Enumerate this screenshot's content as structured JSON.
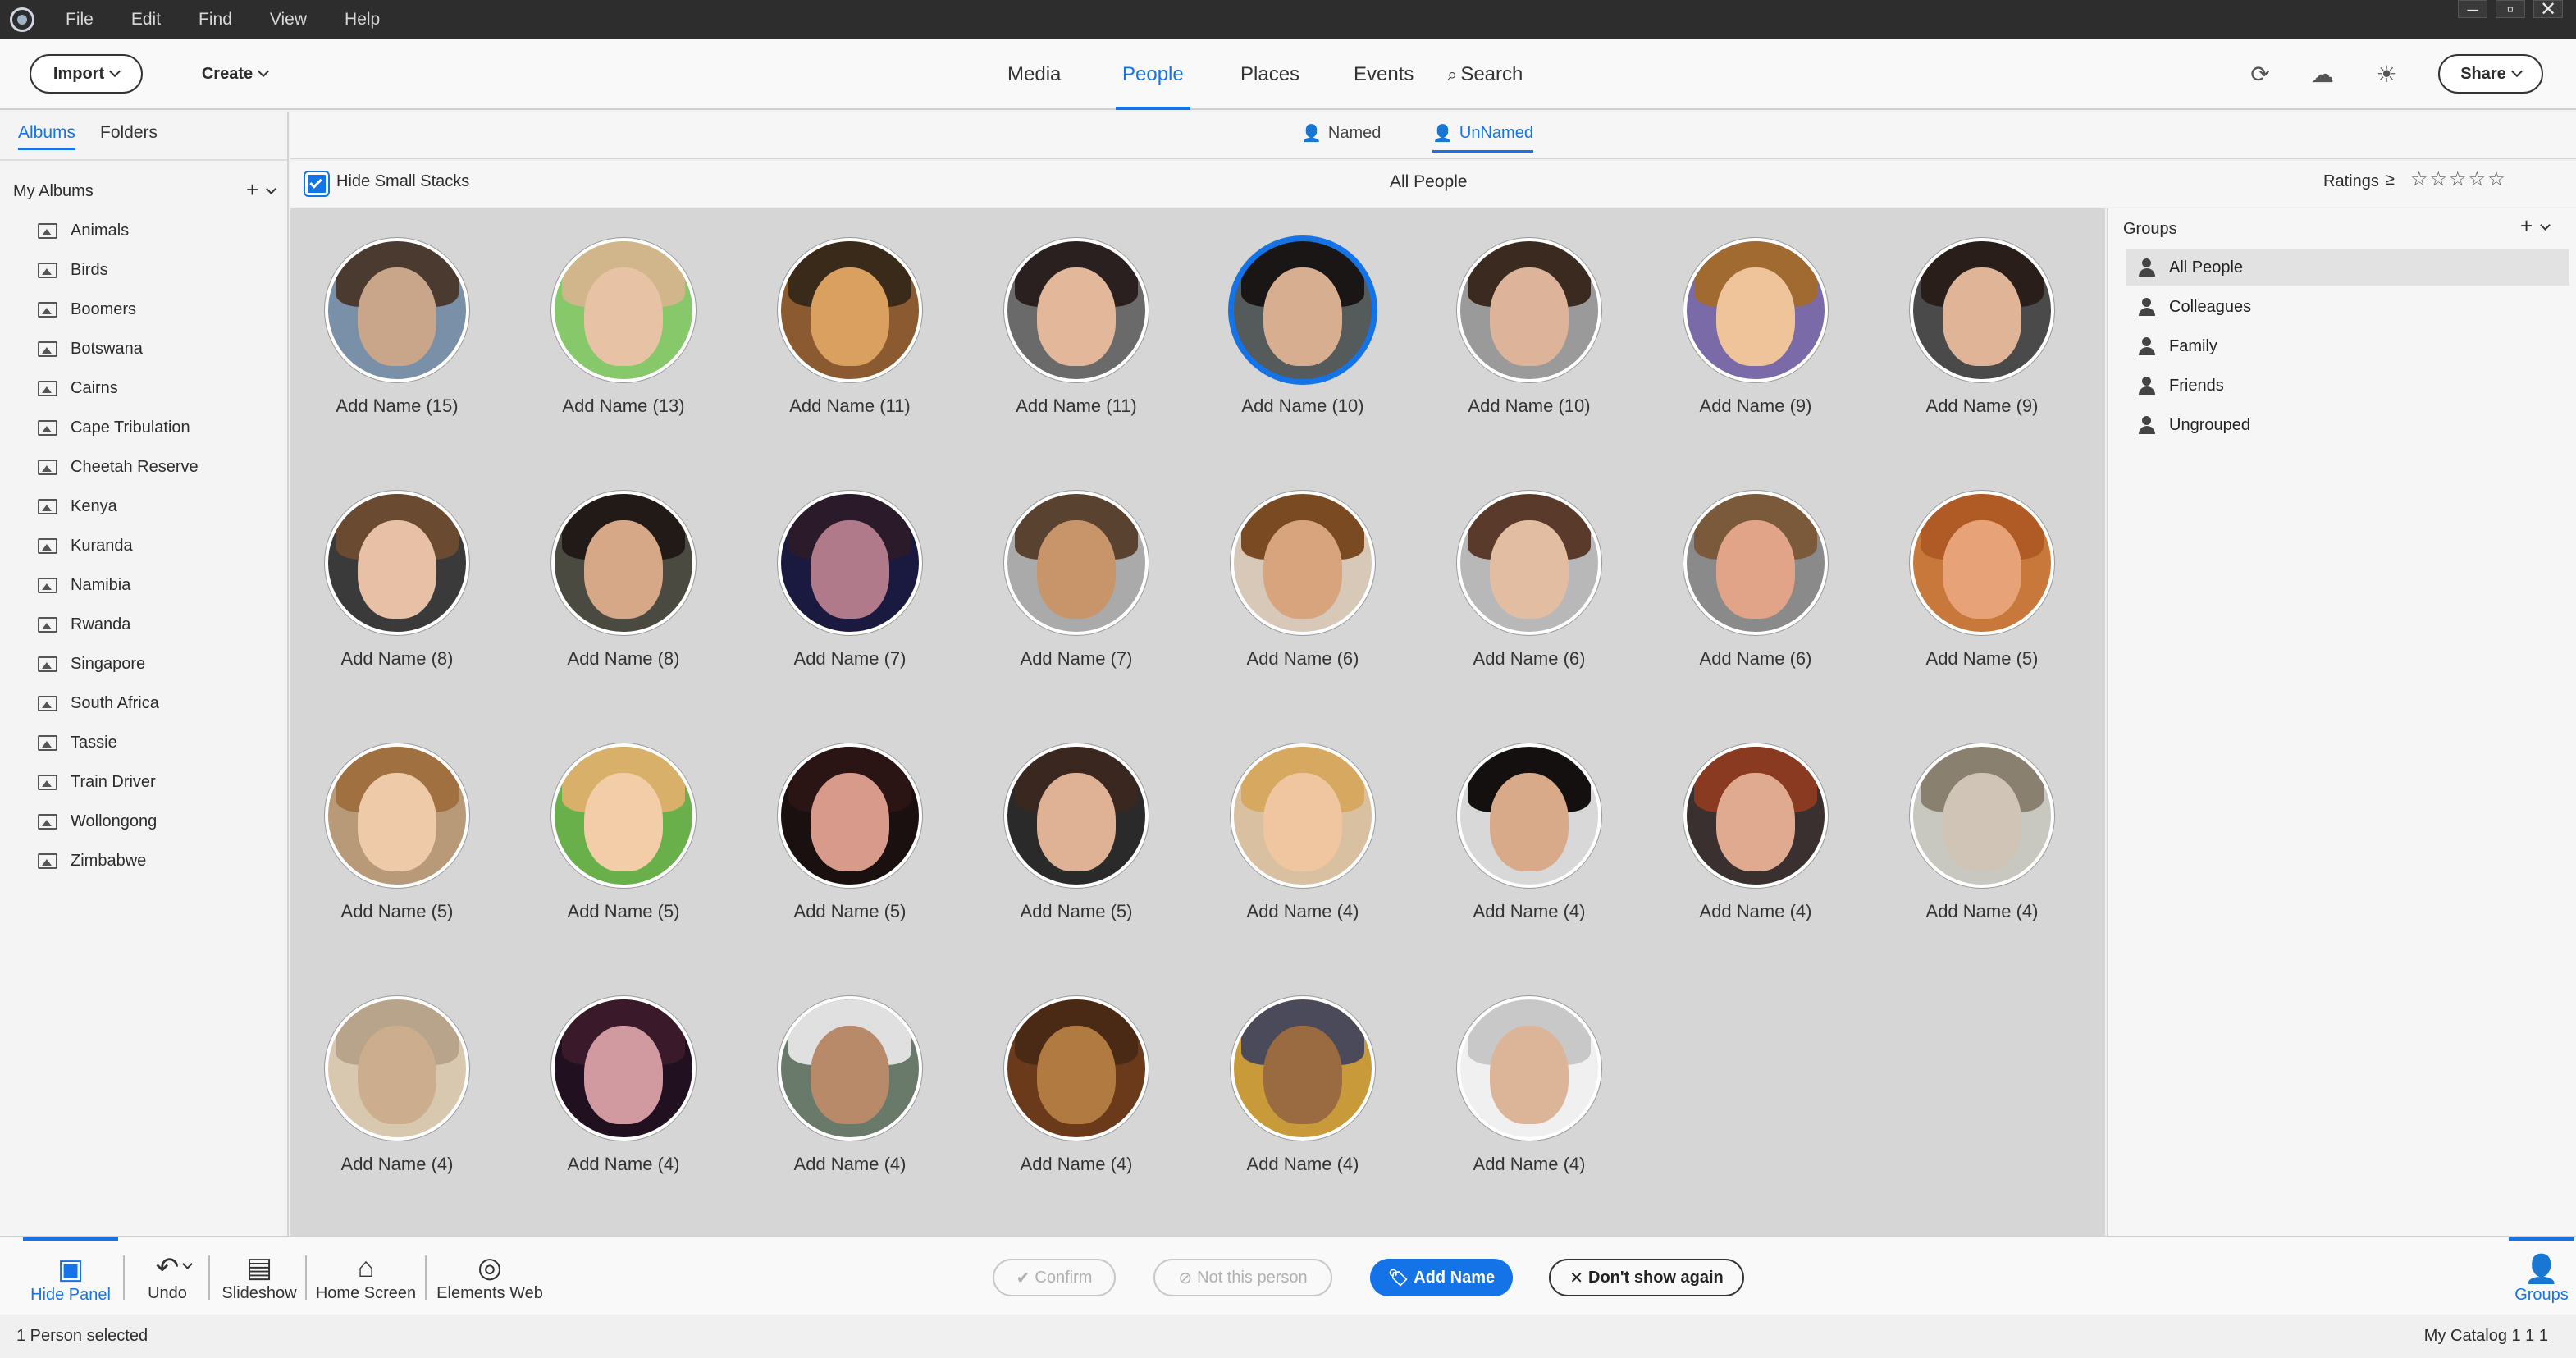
{
  "menubar": {
    "items": [
      "File",
      "Edit",
      "Find",
      "View",
      "Help"
    ]
  },
  "toolbar": {
    "import_label": "Import",
    "create_label": "Create",
    "share_label": "Share",
    "nav_tabs": [
      "Media",
      "People",
      "Places",
      "Events",
      "Search"
    ],
    "active_tab": "People"
  },
  "left_panel": {
    "tabs": [
      "Albums",
      "Folders"
    ],
    "active_tab": "Albums",
    "section_title": "My Albums",
    "albums": [
      "Animals",
      "Birds",
      "Boomers",
      "Botswana",
      "Cairns",
      "Cape Tribulation",
      "Cheetah Reserve",
      "Kenya",
      "Kuranda",
      "Namibia",
      "Rwanda",
      "Singapore",
      "South Africa",
      "Tassie",
      "Train Driver",
      "Wollongong",
      "Zimbabwe"
    ]
  },
  "people_tabs": {
    "named": "Named",
    "unnamed": "UnNamed",
    "active": "UnNamed"
  },
  "filter_bar": {
    "hide_small_stacks": "Hide Small Stacks",
    "hide_small_stacks_checked": true,
    "center_title": "All People",
    "ratings_label": "Ratings",
    "ratings_operator": "≥"
  },
  "faces": [
    {
      "label": "Add Name (15)",
      "bg": "#7a8fa8",
      "skin": "#c9a58a",
      "hair": "#4a3a30",
      "selected": false
    },
    {
      "label": "Add Name (13)",
      "bg": "#86c86a",
      "skin": "#e8c2a4",
      "hair": "#d0b68a",
      "selected": false
    },
    {
      "label": "Add Name (11)",
      "bg": "#8c5a30",
      "skin": "#d9a060",
      "hair": "#3a2a1a",
      "selected": false
    },
    {
      "label": "Add Name (11)",
      "bg": "#6a6a6a",
      "skin": "#e3b89a",
      "hair": "#2a2020",
      "selected": false
    },
    {
      "label": "Add Name (10)",
      "bg": "#555a5a",
      "skin": "#d8ae90",
      "hair": "#1a1616",
      "selected": true
    },
    {
      "label": "Add Name (10)",
      "bg": "#9a9a9a",
      "skin": "#ddb49a",
      "hair": "#3b2a20",
      "selected": false
    },
    {
      "label": "Add Name (9)",
      "bg": "#7a6aa8",
      "skin": "#efc49a",
      "hair": "#a06a30",
      "selected": false
    },
    {
      "label": "Add Name (9)",
      "bg": "#4a4a4a",
      "skin": "#e0b496",
      "hair": "#2a1e1a",
      "selected": false
    },
    {
      "label": "Add Name (8)",
      "bg": "#3a3a3a",
      "skin": "#e7c0a6",
      "hair": "#6a4a30",
      "selected": false
    },
    {
      "label": "Add Name (8)",
      "bg": "#4a4a40",
      "skin": "#d6a888",
      "hair": "#221a16",
      "selected": false
    },
    {
      "label": "Add Name (7)",
      "bg": "#1a1a40",
      "skin": "#b07a8a",
      "hair": "#2a1a2a",
      "selected": false
    },
    {
      "label": "Add Name (7)",
      "bg": "#aaaaaa",
      "skin": "#c8946a",
      "hair": "#5a4230",
      "selected": false
    },
    {
      "label": "Add Name (6)",
      "bg": "#d8c8b8",
      "skin": "#d7a47e",
      "hair": "#7a4a22",
      "selected": false
    },
    {
      "label": "Add Name (6)",
      "bg": "#b8b8b8",
      "skin": "#e2bda2",
      "hair": "#5a3a2a",
      "selected": false
    },
    {
      "label": "Add Name (6)",
      "bg": "#8a8a8a",
      "skin": "#e2a488",
      "hair": "#7a5a3a",
      "selected": false
    },
    {
      "label": "Add Name (5)",
      "bg": "#c8783a",
      "skin": "#e8a278",
      "hair": "#b05a26",
      "selected": false
    },
    {
      "label": "Add Name (5)",
      "bg": "#b89a78",
      "skin": "#efcaa8",
      "hair": "#a07040",
      "selected": false
    },
    {
      "label": "Add Name (5)",
      "bg": "#6ab04a",
      "skin": "#f2cda8",
      "hair": "#d8b06a",
      "selected": false
    },
    {
      "label": "Add Name (5)",
      "bg": "#1a1010",
      "skin": "#d89a8a",
      "hair": "#2a1414",
      "selected": false
    },
    {
      "label": "Add Name (5)",
      "bg": "#2a2a2a",
      "skin": "#dfb296",
      "hair": "#3a2820",
      "selected": false
    },
    {
      "label": "Add Name (4)",
      "bg": "#d8c0a0",
      "skin": "#efc6a0",
      "hair": "#d6a860",
      "selected": false
    },
    {
      "label": "Add Name (4)",
      "bg": "#d8d8d8",
      "skin": "#d8aa8a",
      "hair": "#141010",
      "selected": false
    },
    {
      "label": "Add Name (4)",
      "bg": "#3a3030",
      "skin": "#e0aa90",
      "hair": "#8a3a20",
      "selected": false
    },
    {
      "label": "Add Name (4)",
      "bg": "#c8c8c0",
      "skin": "#cfc4b6",
      "hair": "#8a8070",
      "selected": false
    },
    {
      "label": "Add Name (4)",
      "bg": "#d8c8b0",
      "skin": "#ccae8e",
      "hair": "#b8a48a",
      "selected": false
    },
    {
      "label": "Add Name (4)",
      "bg": "#201020",
      "skin": "#d09aa0",
      "hair": "#3a1a2a",
      "selected": false
    },
    {
      "label": "Add Name (4)",
      "bg": "#6a7a6a",
      "skin": "#b88a6a",
      "hair": "#e0e0e0",
      "selected": false
    },
    {
      "label": "Add Name (4)",
      "bg": "#6a3a1a",
      "skin": "#b07a40",
      "hair": "#4a2a14",
      "selected": false
    },
    {
      "label": "Add Name (4)",
      "bg": "#c89a3a",
      "skin": "#9a6a40",
      "hair": "#4a4a5a",
      "selected": false
    },
    {
      "label": "Add Name (4)",
      "bg": "#f0f0f0",
      "skin": "#dcb498",
      "hair": "#c8c8c8",
      "selected": false
    }
  ],
  "groups_panel": {
    "title": "Groups",
    "items": [
      "All People",
      "Colleagues",
      "Family",
      "Friends",
      "Ungrouped"
    ],
    "active": "All People"
  },
  "bottom_toolbar": {
    "hide_panel": "Hide Panel",
    "undo": "Undo",
    "slideshow": "Slideshow",
    "home_screen": "Home Screen",
    "elements_web": "Elements Web",
    "groups": "Groups"
  },
  "actions": {
    "confirm": "Confirm",
    "not_this_person": "Not this person",
    "add_name": "Add Name",
    "dont_show_again": "Don't show again"
  },
  "status": {
    "left": "1 Person selected",
    "right": "My Catalog 1 1 1"
  },
  "colors": {
    "accent": "#1473e6",
    "menubar": "#2d2d2d",
    "grid_bg": "#d6d6d6"
  }
}
